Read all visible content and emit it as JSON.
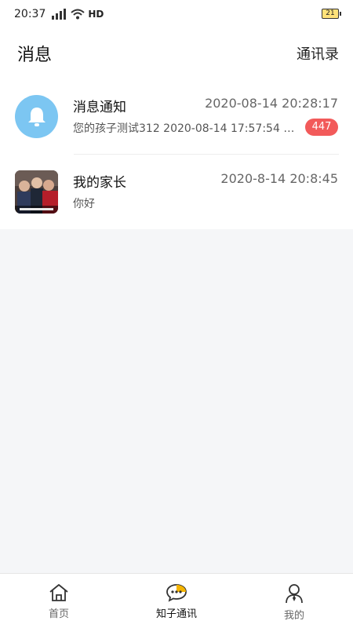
{
  "status_bar": {
    "time": "20:37",
    "network": "HD",
    "battery": "21"
  },
  "header": {
    "title": "消息",
    "contacts_label": "通讯录"
  },
  "conversations": [
    {
      "title": "消息通知",
      "time": "2020-08-14 20:28:17",
      "preview": "您的孩子测试312 2020-08-14 17:57:54 离…",
      "unread": "447",
      "avatar": "bell-icon",
      "avatar_color": "#7cc6f2"
    },
    {
      "title": "我的家长",
      "time": "2020-8-14 20:8:45",
      "preview": "你好",
      "avatar": "group-photo"
    }
  ],
  "tabbar": {
    "items": [
      {
        "label": "首页",
        "icon": "home-icon"
      },
      {
        "label": "知子通讯",
        "icon": "chat-bubble-icon",
        "active": true
      },
      {
        "label": "我的",
        "icon": "person-icon"
      }
    ]
  },
  "colors": {
    "accent_badge": "#f25a5a",
    "bell_avatar": "#7cc6f2",
    "active_dot": "#f5b400"
  }
}
